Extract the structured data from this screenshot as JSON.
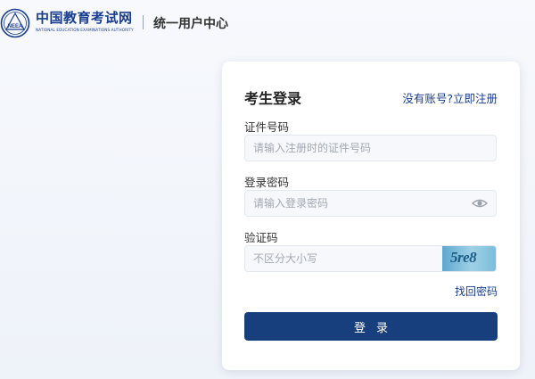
{
  "header": {
    "brand_cn": "中国教育考试网",
    "brand_en": "NATIONAL EDUCATION EXAMINATIONS AUTHORITY",
    "logo_abbr": "NEEA",
    "center_title": "统一用户中心"
  },
  "login": {
    "title": "考生登录",
    "register_link": "没有账号?立即注册",
    "id_label": "证件号码",
    "id_placeholder": "请输入注册时的证件号码",
    "password_label": "登录密码",
    "password_placeholder": "请输入登录密码",
    "captcha_label": "验证码",
    "captcha_placeholder": "不区分大小写",
    "captcha_text": "5re8",
    "forgot_link": "找回密码",
    "submit_label": "登录"
  },
  "colors": {
    "brand": "#1a3d8f",
    "button": "#183f7d"
  }
}
